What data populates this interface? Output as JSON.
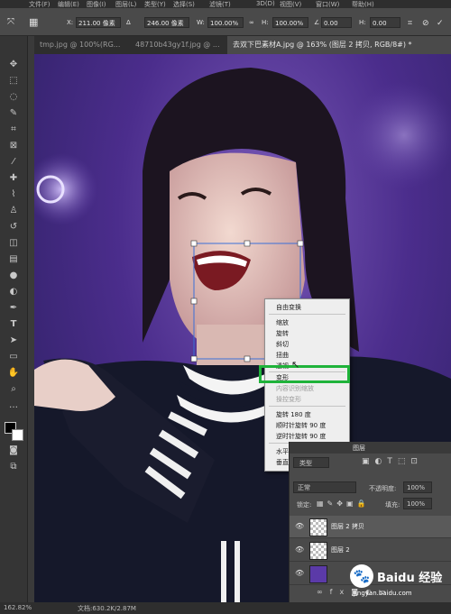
{
  "menubar": {
    "items": [
      "文件(F)",
      "编辑(E)",
      "图像(I)",
      "图层(L)",
      "类型(Y)",
      "选择(S)",
      "滤镜(T)",
      "3D(D)",
      "视图(V)",
      "窗口(W)",
      "帮助(H)"
    ]
  },
  "options": {
    "x_label": "X:",
    "x_value": "211.00 像素",
    "y_value": "246.00 像素",
    "w_label": "W:",
    "w_value": "100.00%",
    "h_label": "H:",
    "h_value": "100.00%",
    "angle_value": "0.00",
    "hskew_label": "H:",
    "hskew_value": "0.00"
  },
  "tabs": [
    {
      "label": "tmp.jpg @ 100%(RG...",
      "active": false
    },
    {
      "label": "48710b43gy1f.jpg @ ...",
      "active": false
    },
    {
      "label": "去双下巴素材A.jpg @ 163% (图层 2 拷贝, RGB/8#) *",
      "active": true
    }
  ],
  "context_menu": {
    "items": [
      {
        "label": "自由变换",
        "disabled": false
      },
      {
        "label": "缩放",
        "disabled": false
      },
      {
        "label": "旋转",
        "disabled": false
      },
      {
        "label": "斜切",
        "disabled": false
      },
      {
        "label": "扭曲",
        "disabled": false
      },
      {
        "label": "透视",
        "disabled": false
      },
      {
        "label": "变形",
        "disabled": false
      },
      {
        "label": "内容识别缩放",
        "disabled": true
      },
      {
        "label": "操控变形",
        "disabled": true
      },
      {
        "label": "旋转 180 度",
        "disabled": false
      },
      {
        "label": "顺时针旋转 90 度",
        "disabled": false
      },
      {
        "label": "逆时针旋转 90 度",
        "disabled": false
      },
      {
        "label": "水平翻转",
        "disabled": false
      },
      {
        "label": "垂直翻转",
        "disabled": false
      }
    ]
  },
  "layers": {
    "panel_title": "图层",
    "filter_kind": "类型",
    "blend_mode": "正常",
    "opacity_label": "不透明度:",
    "opacity_value": "100%",
    "lock_label": "锁定:",
    "fill_label": "填充:",
    "fill_value": "100%",
    "rows": [
      {
        "name": "图层 2 拷贝",
        "selected": true
      },
      {
        "name": "图层 2",
        "selected": false
      },
      {
        "name": "",
        "selected": false
      }
    ]
  },
  "status": {
    "zoom": "162.82%",
    "doc": "文档:630.2K/2.87M"
  },
  "watermark": {
    "brand": "Baidu 经验",
    "url": "jingyan.baidu.com"
  },
  "colors": {
    "highlight": "#1fb33a",
    "accent_purple": "#5b3aa8"
  }
}
